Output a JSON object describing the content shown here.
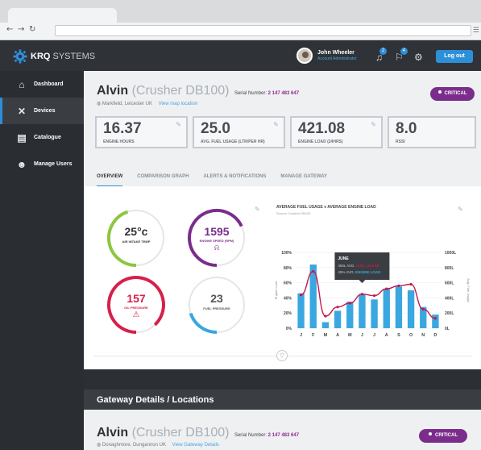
{
  "browser": {
    "back": "←",
    "forward": "→",
    "reload": "↻",
    "menu": "☰"
  },
  "header": {
    "brand_bold": "KRQ",
    "brand_rest": " SYSTEMS",
    "user_name": "John Wheeler",
    "user_role": "Account Administrator",
    "notif_badge": "2",
    "alerts_badge": "4",
    "logout": "Log out"
  },
  "sidebar": {
    "items": [
      {
        "label": "Dashboard",
        "icon": "home-icon",
        "glyph": "⌂"
      },
      {
        "label": "Devices",
        "icon": "devices-icon",
        "glyph": "✕"
      },
      {
        "label": "Catalogue",
        "icon": "catalogue-icon",
        "glyph": "▤"
      },
      {
        "label": "Manage Users",
        "icon": "users-icon",
        "glyph": "☻"
      }
    ]
  },
  "device": {
    "name": "Alvin",
    "model": "(Crusher DB100)",
    "serial_label": "Serial Number:",
    "serial": "2 147 483 647",
    "location": "Markfield, Leicester UK",
    "map_link": "View map location",
    "status": "CRITICAL"
  },
  "stats": [
    {
      "value": "16.37",
      "label": "ENGINE HOURS"
    },
    {
      "value": "25.0",
      "label": "AVG. FUEL USAGE (LTR/PER HR)"
    },
    {
      "value": "421.08",
      "label": "ENGINE LOAD (24HRS)"
    },
    {
      "value": "8.0",
      "label": "RSSI"
    }
  ],
  "tabs": [
    "OVERVIEW",
    "COMPARISON GRAPH",
    "ALERTS & NOTIFICATIONS",
    "MANAGE GATEWAY"
  ],
  "gauges": [
    {
      "value": "25°c",
      "label": "AIR INTAKE TEMP",
      "level": 0.45,
      "color": "#8dc63f",
      "text_color": "#333",
      "icon": ""
    },
    {
      "value": "1595",
      "label": "ENGINE SPEED (RPM)",
      "level": 0.68,
      "color": "#7b2d8c",
      "text_color": "#7b2d8c",
      "icon": "bell-icon",
      "glyph": "🔔"
    },
    {
      "value": "157",
      "label": "OIL PRESSURE",
      "level": 0.88,
      "color": "#d6204b",
      "text_color": "#d6204b",
      "icon": "warning-icon",
      "glyph": "⚠"
    },
    {
      "value": "23",
      "label": "FUEL PRESSURE",
      "level": 0.2,
      "color": "#3aa7e0",
      "text_color": "#333",
      "icon": ""
    }
  ],
  "chart_title": "AVERAGE FUEL USAGE v AVERAGE ENGINE LOAD",
  "chart_source": "Source: Crusher DB100",
  "chart_data": {
    "type": "bar",
    "categories": [
      "J",
      "F",
      "M",
      "A",
      "M",
      "J",
      "J",
      "A",
      "S",
      "O",
      "N",
      "D"
    ],
    "series": [
      {
        "name": "AVG. FUEL USAGE",
        "type": "bar",
        "axis": "left",
        "values": [
          46,
          84,
          8,
          23,
          35,
          45,
          38,
          52,
          55,
          50,
          28,
          18
        ]
      },
      {
        "name": "AVG. ENGINE LOAD",
        "type": "line",
        "axis": "right",
        "values": [
          440,
          750,
          160,
          280,
          330,
          450,
          430,
          520,
          560,
          580,
          250,
          130
        ]
      }
    ],
    "ylabel": "Engine Load",
    "y2label": "Avg. Fuel Usage",
    "ylim": [
      0,
      100
    ],
    "y_ticks": [
      "0%",
      "20%",
      "40%",
      "60%",
      "80%",
      "100%"
    ],
    "y2lim": [
      0,
      1000
    ],
    "y2_ticks": [
      "0L",
      "200L",
      "400L",
      "600L",
      "800L",
      "1000L"
    ],
    "tooltip": {
      "month": "JUNE",
      "line1_value": "450L AVG.",
      "line1_label": "FUEL USAGE",
      "line2_value": "45% AVG.",
      "line2_label": "ENGINE LOAD"
    },
    "colors": {
      "bar": "#3aa7e0",
      "line": "#c4194a"
    }
  },
  "gateway": {
    "header": "Gateway Details / Locations",
    "name": "Alvin",
    "model": "(Crusher DB100)",
    "serial_label": "Serial Number:",
    "serial": "2 147 483 647",
    "location": "Donaghmore, Dungannon UK",
    "link": "View Gateway Details",
    "status": "CRITICAL"
  }
}
